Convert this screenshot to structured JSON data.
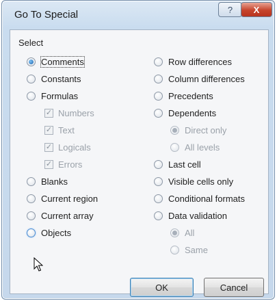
{
  "window": {
    "title": "Go To Special",
    "help_glyph": "?",
    "close_glyph": "X"
  },
  "select_label": "Select",
  "left_options": [
    {
      "label": "Comments",
      "checked": true,
      "focused": true
    },
    {
      "label": "Constants"
    },
    {
      "label": "Formulas"
    },
    {
      "label": "Blanks"
    },
    {
      "label": "Current region"
    },
    {
      "label": "Current array"
    },
    {
      "label": "Objects",
      "hover": true
    }
  ],
  "formula_suboptions": [
    {
      "label": "Numbers",
      "checked": true
    },
    {
      "label": "Text",
      "checked": true
    },
    {
      "label": "Logicals",
      "checked": true
    },
    {
      "label": "Errors",
      "checked": true
    }
  ],
  "right_options": [
    {
      "label": "Row differences"
    },
    {
      "label": "Column differences"
    },
    {
      "label": "Precedents"
    },
    {
      "label": "Dependents"
    },
    {
      "label": "Last cell"
    },
    {
      "label": "Visible cells only"
    },
    {
      "label": "Conditional formats"
    },
    {
      "label": "Data validation"
    }
  ],
  "dependents_suboptions": [
    {
      "label": "Direct only",
      "checked": true
    },
    {
      "label": "All levels"
    }
  ],
  "validation_suboptions": [
    {
      "label": "All",
      "checked": true
    },
    {
      "label": "Same"
    }
  ],
  "buttons": {
    "ok": "OK",
    "cancel": "Cancel"
  }
}
